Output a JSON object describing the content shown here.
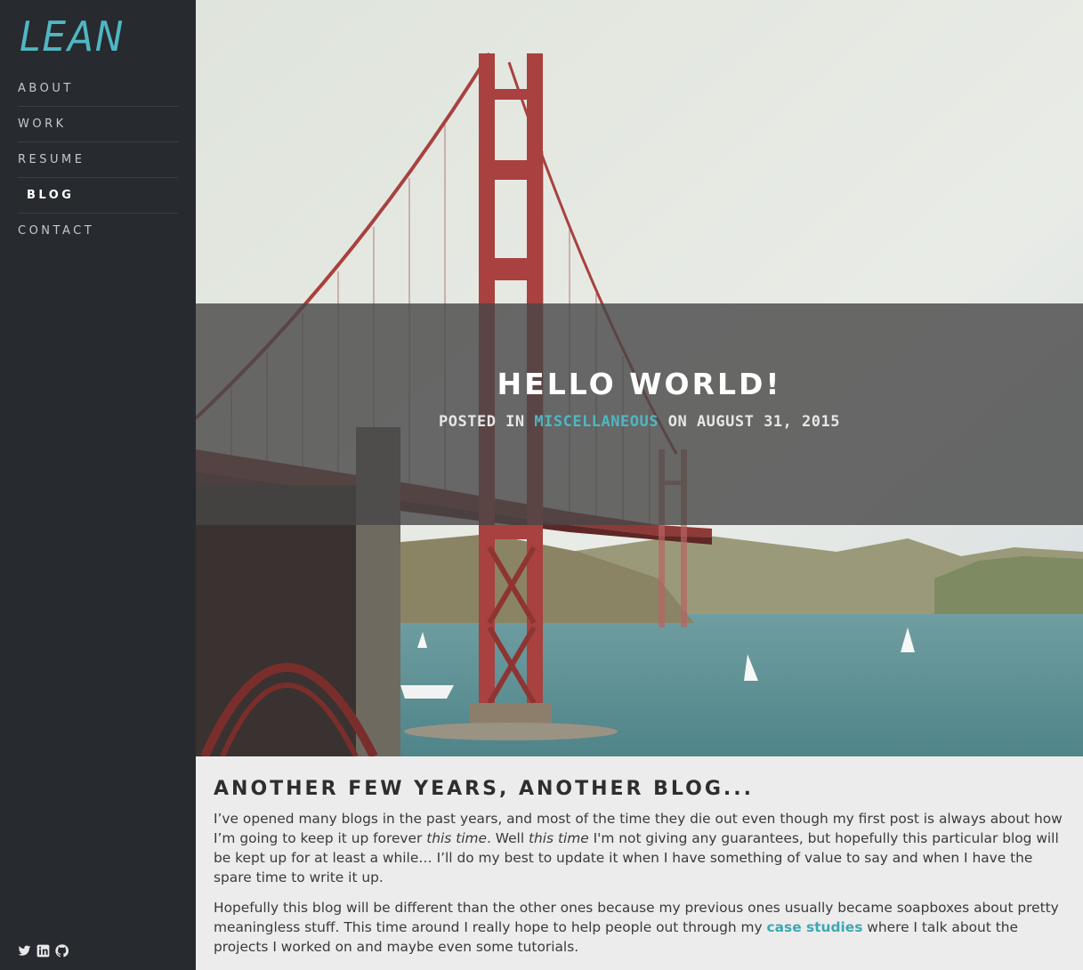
{
  "sidebar": {
    "logo": "LEAN",
    "nav": [
      "ABOUT",
      "WORK",
      "RESUME",
      "BLOG",
      "CONTACT"
    ],
    "active_nav": "BLOG",
    "social_icons": [
      "twitter-icon",
      "linkedin-icon",
      "github-icon"
    ]
  },
  "hero": {
    "title": "HELLO WORLD!",
    "meta_prefix": "POSTED IN",
    "category": "MISCELLANEOUS",
    "meta_on": "ON",
    "date": "AUGUST 31, 2015"
  },
  "article": {
    "heading": "ANOTHER FEW YEARS, ANOTHER BLOG...",
    "p1_a": "I’ve opened many blogs in the past years, and most of the time they die out even though my first post is always about how I’m going to keep it up forever ",
    "p1_em1": "this time",
    "p1_b": ". Well ",
    "p1_em2": "this time",
    "p1_c": " I'm not giving any guarantees, but hopefully this particular blog will be kept up for at least a while… I’ll do my best to update it when I have something of value to say and when I have the spare time to write it up.",
    "p2_a": "Hopefully this blog will be different than the other ones because my previous ones usually became soapboxes about pretty meaningless stuff. This time around I really hope to help people out through my ",
    "p2_link": "case studies",
    "p2_b": " where I talk about the projects I worked on and maybe even some tutorials."
  },
  "colors": {
    "accent": "#4fb7c3",
    "sidebar_bg": "#272a2f",
    "bridge_red": "#a8413f"
  }
}
